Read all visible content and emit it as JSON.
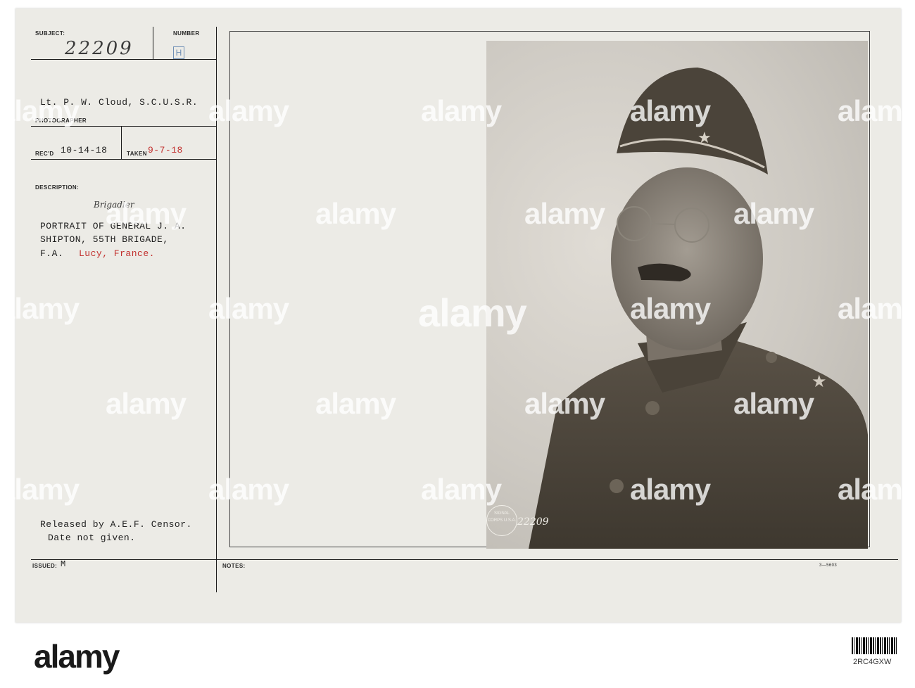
{
  "card": {
    "subject_label": "SUBJECT:",
    "subject_value": "22209",
    "number_label": "NUMBER",
    "number_value": "H",
    "photographer_value": "Lt. P. W. Cloud, S.C.U.S.R.",
    "photographer_label": "PHOTOGRAPHER",
    "recd_label": "REC'D",
    "recd_value": "10-14-18",
    "taken_label": "TAKEN",
    "taken_value": "9-7-18",
    "description_label": "DESCRIPTION:",
    "description_handwritten": "Brigadier",
    "description_line1": "PORTRAIT OF GENERAL J. A.",
    "description_line2": "SHIPTON, 55TH BRIGADE,",
    "description_line3a": "F.A.",
    "description_line3b": "Lucy, France.",
    "release_line1": "Released by A.E.F. Censor.",
    "release_line2": "Date not given.",
    "issued_label": "ISSUED:",
    "issued_value": "M",
    "notes_label": "NOTES:",
    "form_code": "3—5603"
  },
  "photo": {
    "stamp_text": "SIGNAL CORPS U.S.A.",
    "stamp_number": "22209"
  },
  "watermarks": {
    "text": "alamy"
  },
  "footer": {
    "brand": "alamy",
    "image_id": "2RC4GXW"
  }
}
